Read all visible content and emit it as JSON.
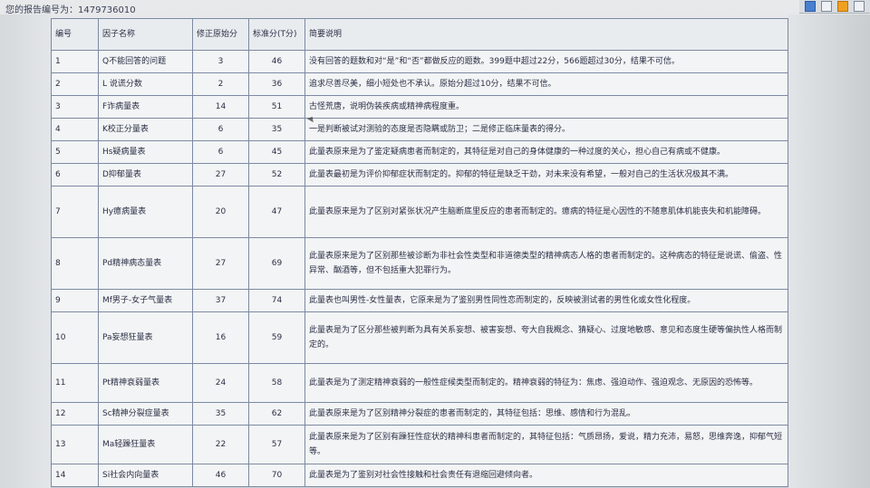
{
  "header": {
    "report_id_label": "您的报告编号为：1479736010"
  },
  "table": {
    "columns": [
      "编号",
      "因子名称",
      "修正原始分",
      "标准分(T分)",
      "简要说明"
    ],
    "rows": [
      {
        "id": "1",
        "name": "Q不能回答的问题",
        "raw": "3",
        "t": "46",
        "desc": "没有回答的题数和对“是”和“否”都做反应的题数。399题中超过22分，566题超过30分，结果不可信。"
      },
      {
        "id": "2",
        "name": "L 说谎分数",
        "raw": "2",
        "t": "36",
        "desc": "追求尽善尽美，细小短处也不承认。原始分超过10分，结果不可信。"
      },
      {
        "id": "3",
        "name": "F诈病量表",
        "raw": "14",
        "t": "51",
        "desc": "古怪荒唐，说明伪装疾病或精神病程度重。"
      },
      {
        "id": "4",
        "name": "K校正分量表",
        "raw": "6",
        "t": "35",
        "desc": "一是判断被试对测验的态度是否隐瞒或防卫；二是修正临床量表的得分。"
      },
      {
        "id": "5",
        "name": "Hs疑病量表",
        "raw": "6",
        "t": "45",
        "desc": "此量表原来是为了鉴定疑病患者而制定的，其特征是对自己的身体健康的一种过度的关心，担心自己有病或不健康。"
      },
      {
        "id": "6",
        "name": "D抑郁量表",
        "raw": "27",
        "t": "52",
        "desc": "此量表最初是为评价抑郁症状而制定的。抑郁的特征是缺乏干劲，对未来没有希望，一般对自己的生活状况极其不满。"
      },
      {
        "id": "7",
        "name": "Hy癔病量表",
        "raw": "20",
        "t": "47",
        "desc": "此量表原来是为了区别对紧张状况产生脑断底里反应的患者而制定的。癔病的特征是心因性的不随意肌体机能丧失和机能障碍。"
      },
      {
        "id": "8",
        "name": "Pd精神病态量表",
        "raw": "27",
        "t": "69",
        "desc": "此量表原来是为了区别那些被诊断为非社会性类型和非道德类型的精神病态人格的患者而制定的。这种病态的特征是说谎、偷盗、性异常、酗酒等，但不包括重大犯罪行为。"
      },
      {
        "id": "9",
        "name": "Mf男子-女子气量表",
        "raw": "37",
        "t": "74",
        "desc": "此量表也叫男性-女性量表，它原来是为了鉴别男性同性恋而制定的，反映被测试者的男性化或女性化程度。"
      },
      {
        "id": "10",
        "name": "Pa妄想狂量表",
        "raw": "16",
        "t": "59",
        "desc": "此量表是为了区分那些被判断为具有关系妄想、被害妄想、夸大自我概念、猜疑心、过度地敏感、意见和态度生硬等偏执性人格而制定的。"
      },
      {
        "id": "11",
        "name": "Pt精神衰弱量表",
        "raw": "24",
        "t": "58",
        "desc": "此量表是为了测定精神衰弱的一般性症候类型而制定的。精神衰弱的特征为：焦虑、强迫动作、强迫观念、无原因的恐怖等。"
      },
      {
        "id": "12",
        "name": "Sc精神分裂症量表",
        "raw": "35",
        "t": "62",
        "desc": "此量表原来是为了区别精神分裂症的患者而制定的，其特征包括：思维、感情和行为混乱。"
      },
      {
        "id": "13",
        "name": "Ma轻躁狂量表",
        "raw": "22",
        "t": "57",
        "desc": "此量表原来是为了区别有躁狂性症状的精神科患者而制定的，其特征包括：气质昂扬，爱说，精力充沛，易怒，思维奔逸，抑郁气短等。"
      },
      {
        "id": "14",
        "name": "Si社会内向量表",
        "raw": "46",
        "t": "70",
        "desc": "此量表是为了鉴别对社会性接触和社会责任有退缩回避倾向者。"
      }
    ]
  }
}
